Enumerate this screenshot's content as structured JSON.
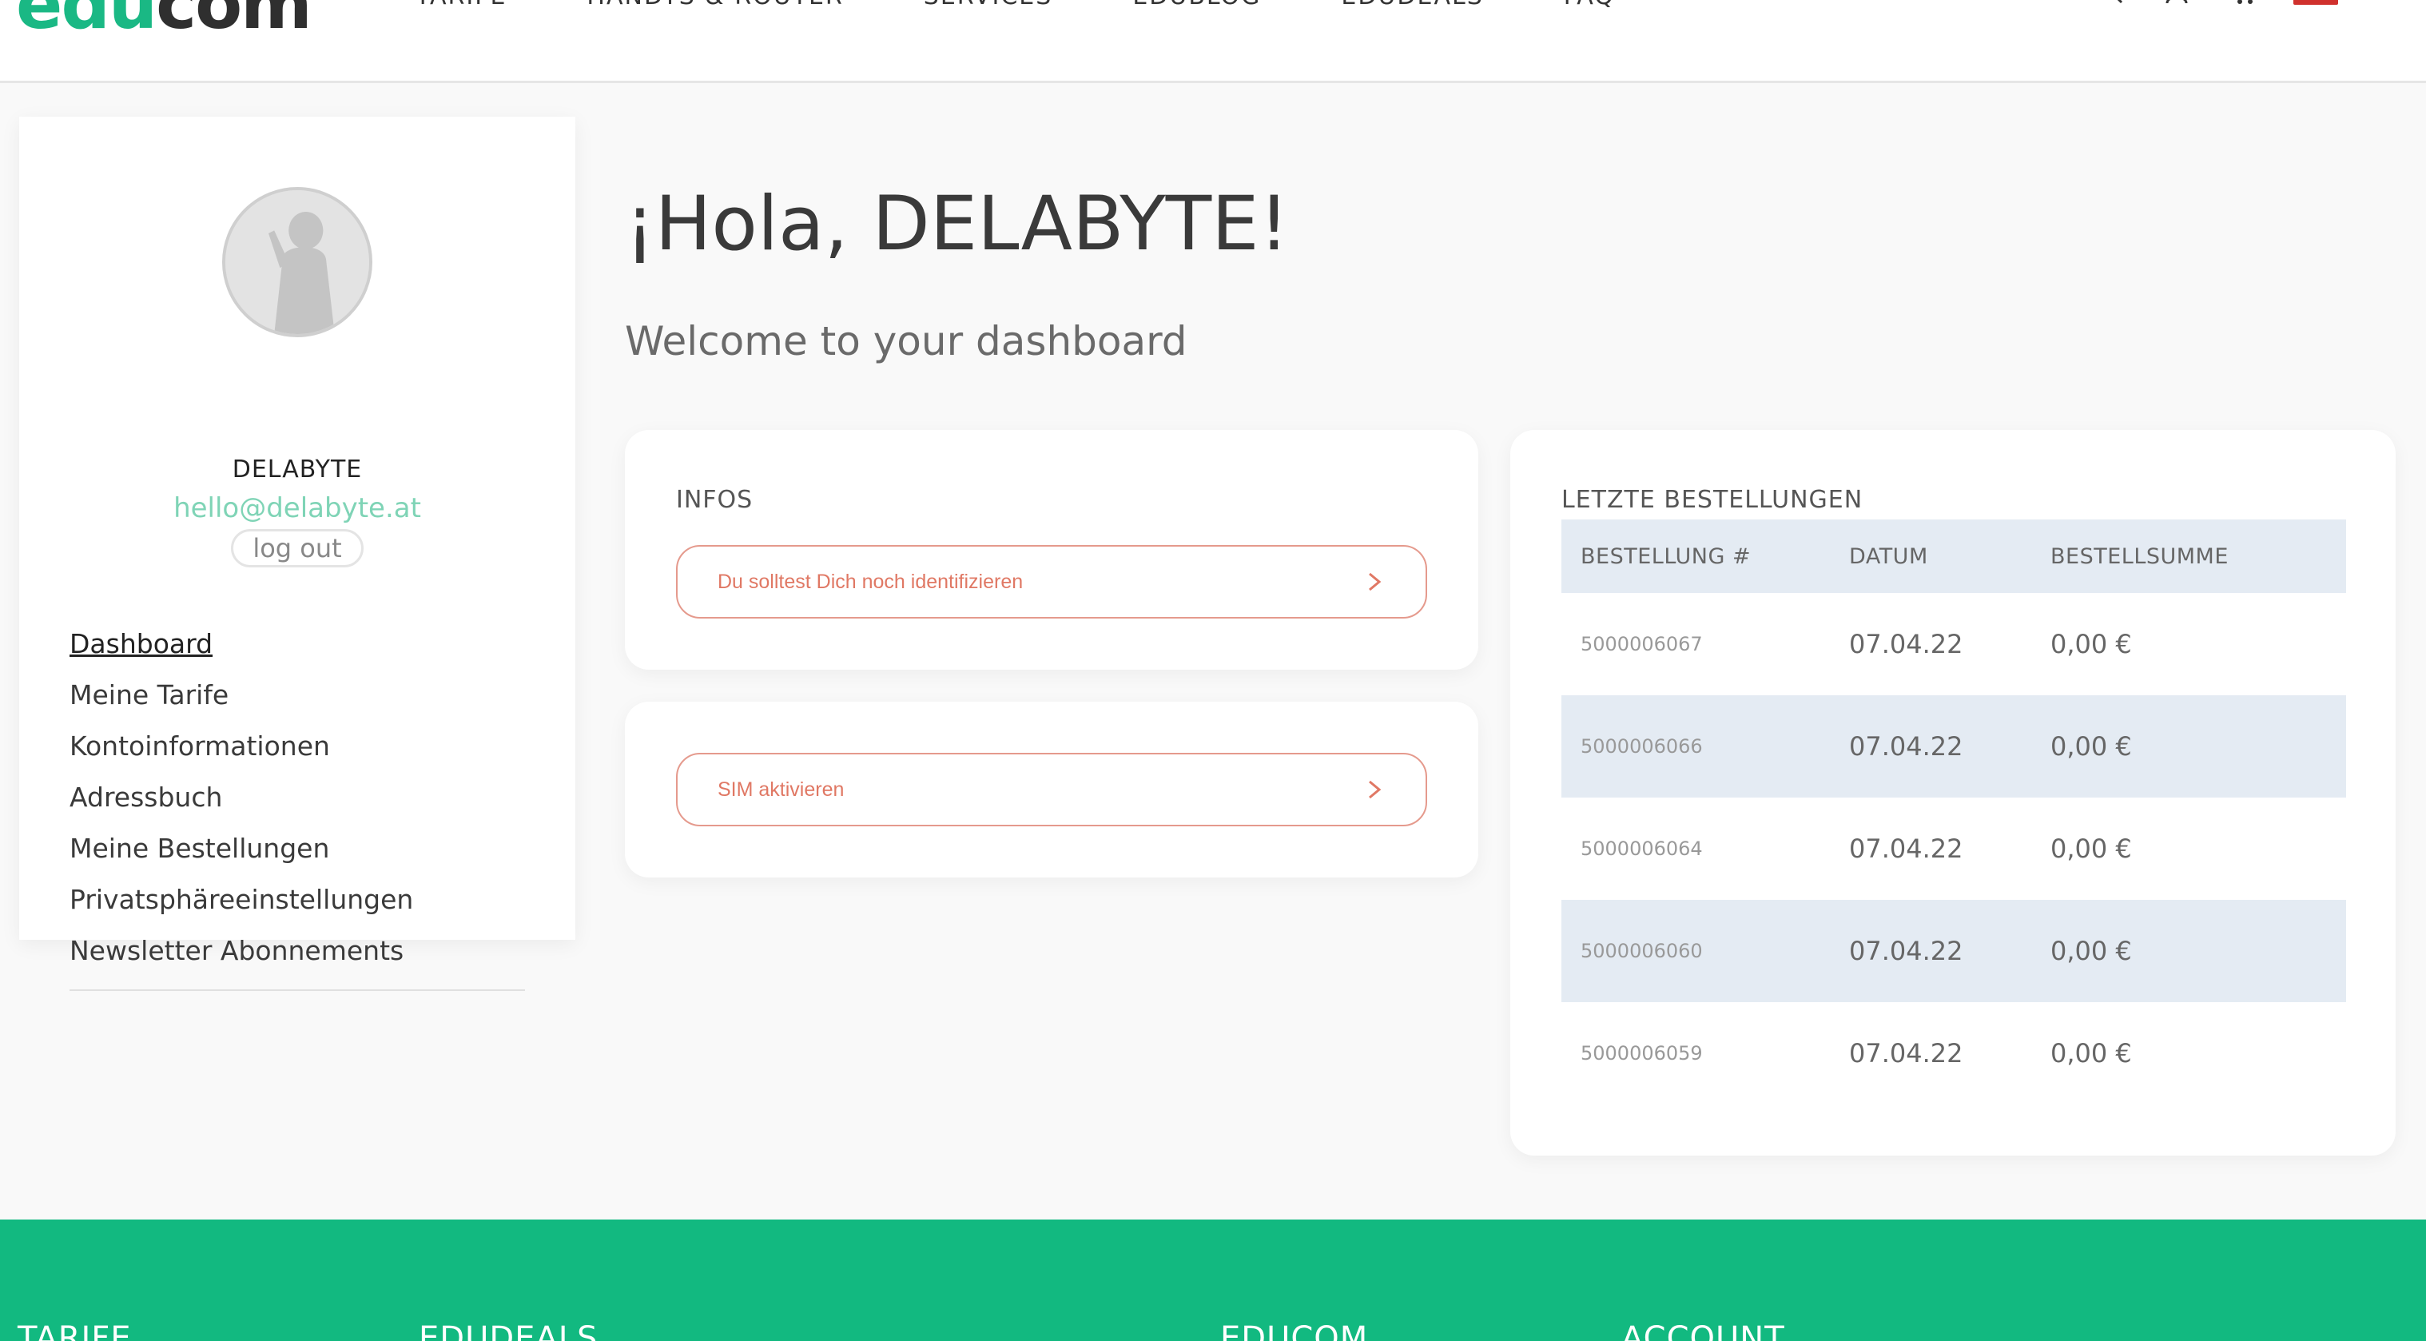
{
  "header": {
    "logo": {
      "part1": "edu",
      "part2": "com"
    },
    "nav": [
      "TARIFE",
      "HANDYS & ROUTER",
      "SERVICES",
      "EDUBLOG",
      "EDUDEALS",
      "FAQ"
    ],
    "icons": [
      "search-icon",
      "user-icon",
      "cart-icon",
      "flag-icon"
    ]
  },
  "sidebar": {
    "user_name": "DELABYTE",
    "user_email": "hello@delabyte.at",
    "logout_label": "log out",
    "menu": [
      {
        "label": "Dashboard",
        "active": true
      },
      {
        "label": "Meine Tarife"
      },
      {
        "label": "Kontoinformationen"
      },
      {
        "label": "Adressbuch"
      },
      {
        "label": "Meine Bestellungen"
      },
      {
        "label": "Privatsphäreeinstellungen"
      },
      {
        "label": "Newsletter Abonnements"
      }
    ]
  },
  "main": {
    "greeting": "¡Hola, DELABYTE!",
    "welcome": "Welcome to your dashboard",
    "infos": {
      "title": "INFOS",
      "action_label": "Du solltest Dich noch identifizieren"
    },
    "sim": {
      "action_label": "SIM aktivieren"
    },
    "orders": {
      "title": "LETZTE BESTELLUNGEN",
      "columns": [
        "BESTELLUNG #",
        "DATUM",
        "BESTELLSUMME"
      ],
      "rows": [
        {
          "id": "5000006067",
          "date": "07.04.22",
          "total": "0,00 €"
        },
        {
          "id": "5000006066",
          "date": "07.04.22",
          "total": "0,00 €"
        },
        {
          "id": "5000006064",
          "date": "07.04.22",
          "total": "0,00 €"
        },
        {
          "id": "5000006060",
          "date": "07.04.22",
          "total": "0,00 €"
        },
        {
          "id": "5000006059",
          "date": "07.04.22",
          "total": "0,00 €"
        }
      ]
    }
  },
  "footer": {
    "columns": [
      "TARIFE",
      "EDUDEALS",
      "EDUCOM",
      "ACCOUNT"
    ]
  },
  "colors": {
    "brand_green": "#12b980",
    "accent_red": "#e07864",
    "table_stripe": "#e4ebf3",
    "email_green": "#7fd4b6"
  }
}
